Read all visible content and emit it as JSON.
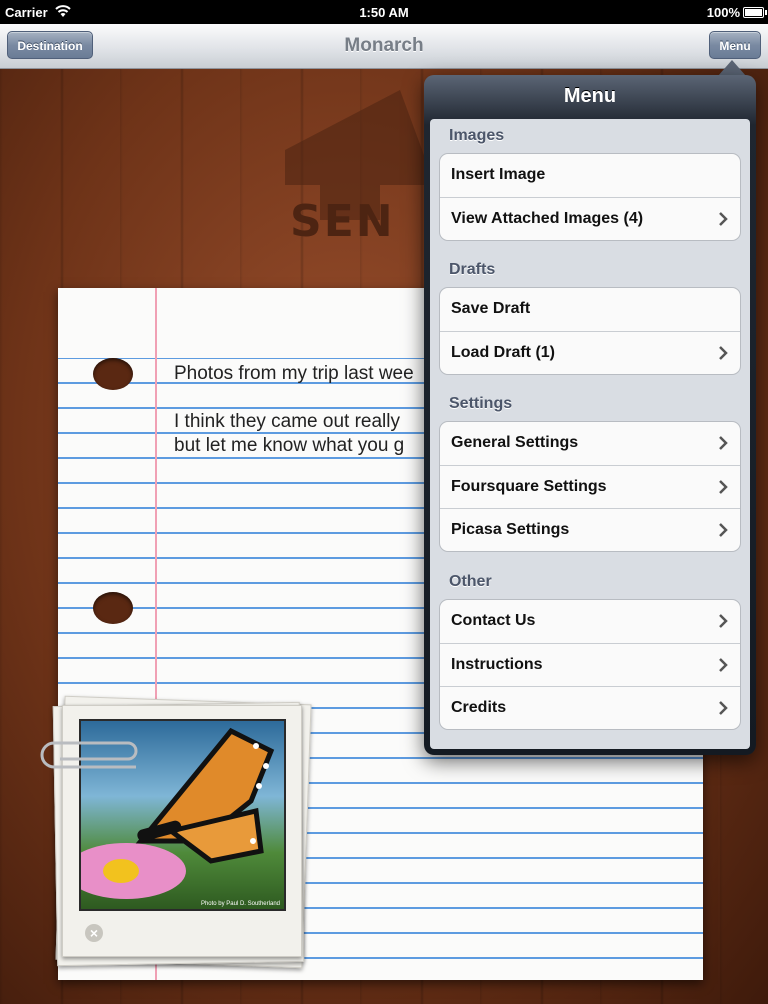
{
  "status_bar": {
    "carrier": "Carrier",
    "time": "1:50 AM",
    "battery": "100%"
  },
  "nav": {
    "title": "Monarch",
    "left_button": "Destination",
    "right_button": "Menu"
  },
  "background": {
    "logo_text": "SEN"
  },
  "note": {
    "lines": [
      "Photos from my trip last wee",
      "I think they came out really",
      "but let me know what you g"
    ]
  },
  "photo": {
    "credit": "Photo by Paul D. Southerland"
  },
  "menu": {
    "title": "Menu",
    "sections": [
      {
        "header": "Images",
        "items": [
          {
            "label": "Insert Image",
            "chevron": false
          },
          {
            "label": "View Attached Images (4)",
            "chevron": true
          }
        ]
      },
      {
        "header": "Drafts",
        "items": [
          {
            "label": "Save Draft",
            "chevron": false
          },
          {
            "label": "Load Draft (1)",
            "chevron": true
          }
        ]
      },
      {
        "header": "Settings",
        "items": [
          {
            "label": "General Settings",
            "chevron": true
          },
          {
            "label": "Foursquare Settings",
            "chevron": true
          },
          {
            "label": "Picasa Settings",
            "chevron": true
          }
        ]
      },
      {
        "header": "Other",
        "items": [
          {
            "label": "Contact Us",
            "chevron": true
          },
          {
            "label": "Instructions",
            "chevron": true
          },
          {
            "label": "Credits",
            "chevron": true
          }
        ]
      }
    ]
  },
  "colors": {
    "nav_button": "#7a8aa2",
    "popover": "#1f2630",
    "ruled_line": "#5d9be0",
    "margin_line": "#f0a0b4"
  }
}
